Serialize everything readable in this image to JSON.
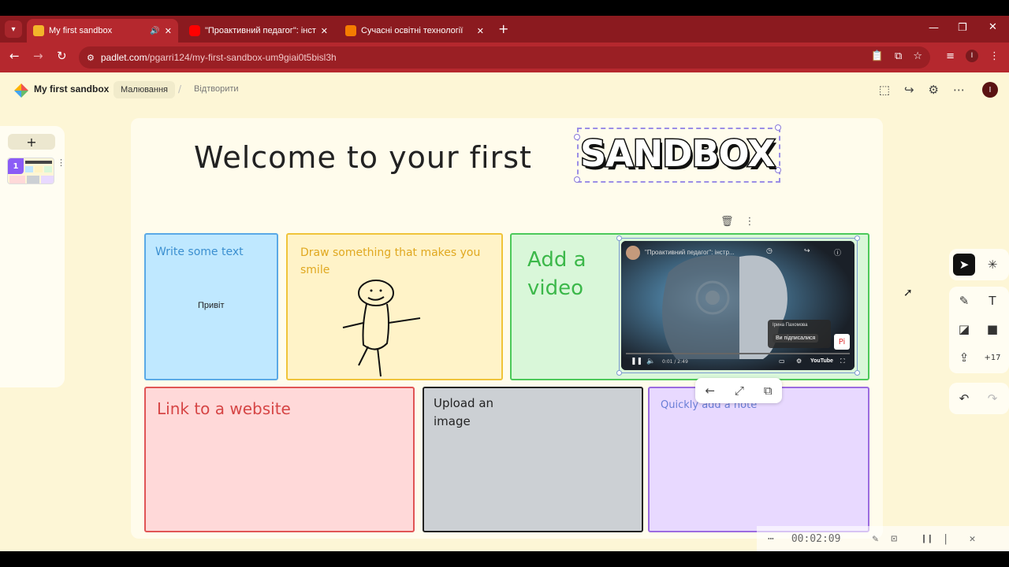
{
  "browser": {
    "tabs": [
      {
        "title": "My first sandbox",
        "active": true,
        "favicon_color": "#f3b52a"
      },
      {
        "title": "\"Проактивний педагог\": інстру",
        "active": false,
        "favicon_color": "#ff0000"
      },
      {
        "title": "Сучасні освітні технології",
        "active": false,
        "favicon_color": "#f57c00"
      }
    ],
    "url_host": "padlet.com",
    "url_path": "/pgarri124/my-first-sandbox-um9giai0t5bisl3h",
    "profile_initial": "I"
  },
  "padlet": {
    "board_title": "My first sandbox",
    "mode_label": "Малювання",
    "reopen_label": "Відтворити",
    "user_initial": "I",
    "slide_number": "1",
    "add_slide_label": "+"
  },
  "canvas": {
    "welcome_text": "Welcome to your first",
    "sandbox_text": "SANDBOX",
    "cards": {
      "write_text_label": "Write some text",
      "write_text_content": "Привіт",
      "draw_label": "Draw something that makes you smile",
      "video_label": "Add a video",
      "link_label": "Link to a website",
      "upload_label": "Upload an image",
      "note_label": "Quickly add a note"
    },
    "video": {
      "title": "\"Проактивний педагог\": інстр...",
      "caption_name": "Ірина Пахомова",
      "caption_button": "Ви підписалися",
      "time": "0:01 / 2:49",
      "brand": "YouTube"
    }
  },
  "toolbar": {
    "more_count": "+17"
  },
  "recorder": {
    "time": "00:02:09"
  }
}
